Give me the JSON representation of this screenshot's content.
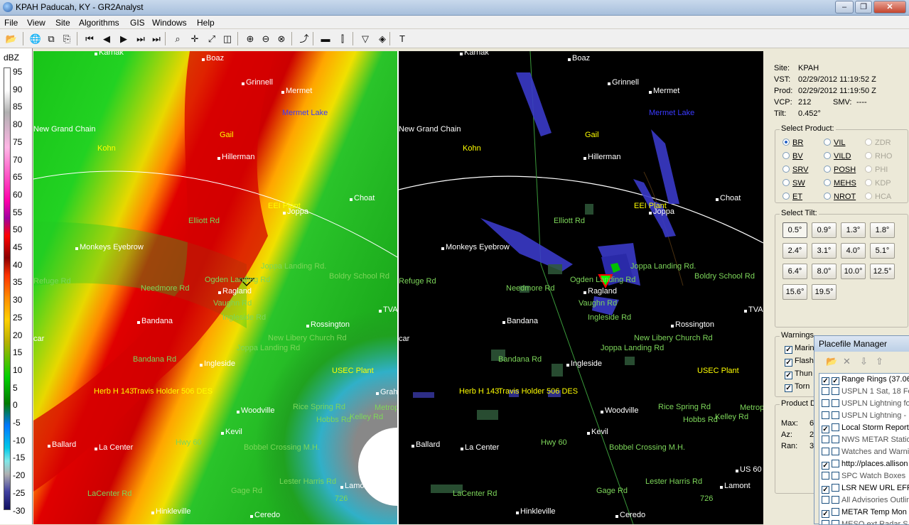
{
  "window": {
    "title": "KPAH Paducah, KY - GR2Analyst",
    "minimize": "–",
    "restore": "❐",
    "close": "✕"
  },
  "menu": [
    "File",
    "View",
    "Site",
    "Algorithms",
    "GIS",
    "Windows",
    "Help"
  ],
  "toolbar": {
    "icons": [
      "open-folder-icon",
      "globe-icon",
      "copy-icon",
      "export-icon",
      "first-frame-icon",
      "previous-frame-icon",
      "play-icon",
      "next-frame-icon",
      "last-frame-icon",
      "zoom-icon",
      "pan-icon",
      "measure-icon",
      "cube-icon",
      "zoom-in-icon",
      "zoom-out-icon",
      "zoom-reset-icon",
      "cross-section-icon",
      "storm-motion-icon",
      "split-icon",
      "filter-icon",
      "filter-options-icon",
      "text-icon"
    ],
    "glyphs": [
      "📂",
      "🌐",
      "⧉",
      "⎘",
      "⏮",
      "◀",
      "▶",
      "⏭",
      "⏭",
      "⌕",
      "✛",
      "⤢",
      "◫",
      "⊕",
      "⊖",
      "⊗",
      "⤴",
      "▬",
      "⫿",
      "▽",
      "◈",
      "T"
    ]
  },
  "colorbar": {
    "unit": "dBZ",
    "ticks": [
      "95",
      "90",
      "85",
      "80",
      "75",
      "70",
      "65",
      "60",
      "55",
      "50",
      "45",
      "40",
      "35",
      "30",
      "25",
      "20",
      "15",
      "10",
      "5",
      "0",
      "-5",
      "-10",
      "-15",
      "-20",
      "-25",
      "-30"
    ]
  },
  "map_labels": {
    "white": [
      "Karnak",
      "Boaz",
      "Grinnell",
      "Mermet",
      "New Grand Chain",
      "Hillerman",
      "Choat",
      "Joppa",
      "Monkeys Eyebrow",
      "Ragland",
      "Bandana",
      "Rossington",
      "Ingleside",
      "Woodville",
      "Kevil",
      "Ballard",
      "La Center",
      "Lamont",
      "Hinkleville",
      "Ceredo",
      "US 60",
      "Grah",
      "TVA",
      "car"
    ],
    "yellow": [
      "Gail",
      "Kohn",
      "EEI Plant",
      "USEC Plant",
      "Herb H 143",
      "Travis Holder 506 DES"
    ],
    "green": [
      "Elliott Rd",
      "Ogden Landing Rd",
      "Joppa Landing Rd.",
      "Boldry School Rd",
      "Needmore Rd",
      "Vaughn Rd",
      "Ingleside Rd",
      "New Libery Church Rd",
      "Joppa Landing Rd",
      "Bandana Rd",
      "Rice Spring Rd",
      "Hobbs Rd",
      "Kelley Rd",
      "Hwy 60",
      "Bobbel Crossing M.H.",
      "Lester Harris Rd",
      "Gage Rd",
      "LaCenter Rd",
      "726",
      "Refuge Rd",
      "Metrop"
    ],
    "blue": [
      "Mermet Lake"
    ]
  },
  "info": {
    "site_label": "Site:",
    "site": "KPAH",
    "vst_label": "VST:",
    "vst": "02/29/2012  11:19:52 Z",
    "prod_label": "Prod:",
    "prod": "02/29/2012  11:19:50 Z",
    "vcp_label": "VCP:",
    "vcp": "212",
    "smv_label": "SMV:",
    "smv": "----",
    "tilt_label": "Tilt:",
    "tilt": "0.452°"
  },
  "select_product": {
    "label": "Select Product:",
    "options": [
      {
        "label": "BR",
        "enabled": true,
        "selected": true
      },
      {
        "label": "VIL",
        "enabled": true
      },
      {
        "label": "ZDR",
        "enabled": false
      },
      {
        "label": "BV",
        "enabled": true
      },
      {
        "label": "VILD",
        "enabled": true
      },
      {
        "label": "RHO",
        "enabled": false
      },
      {
        "label": "SRV",
        "enabled": true
      },
      {
        "label": "POSH",
        "enabled": true
      },
      {
        "label": "PHI",
        "enabled": false
      },
      {
        "label": "SW",
        "enabled": true
      },
      {
        "label": "MEHS",
        "enabled": true
      },
      {
        "label": "KDP",
        "enabled": false
      },
      {
        "label": "ET",
        "enabled": true
      },
      {
        "label": "NROT",
        "enabled": true
      },
      {
        "label": "HCA",
        "enabled": false
      }
    ]
  },
  "select_tilt": {
    "label": "Select Tilt:",
    "options": [
      "0.5°",
      "0.9°",
      "1.3°",
      "1.8°",
      "2.4°",
      "3.1°",
      "4.0°",
      "5.1°",
      "6.4°",
      "8.0°",
      "10.0°",
      "12.5°",
      "15.6°",
      "19.5°"
    ],
    "selected": "0.5°"
  },
  "warnings": {
    "label": "Warnings",
    "items": [
      "Marin",
      "Flash",
      "Thun",
      "Torn"
    ]
  },
  "product_data": {
    "label": "Product D",
    "max_label": "Max:",
    "max": "6",
    "az_label": "Az:",
    "az": "2",
    "ran_label": "Ran:",
    "ran": "3"
  },
  "placefile_manager": {
    "title": "Placefile Manager",
    "items": [
      {
        "label": "Range Rings (37.06",
        "a": true,
        "b": true
      },
      {
        "label": "USPLN 1 Sat, 18 Fe",
        "a": false,
        "b": false
      },
      {
        "label": "USPLN Lightning fo",
        "a": false,
        "b": false
      },
      {
        "label": "USPLN Lightning - ",
        "a": false,
        "b": false
      },
      {
        "label": "Local Storm Reports",
        "a": true,
        "b": false
      },
      {
        "label": "NWS METAR Statio",
        "a": false,
        "b": false
      },
      {
        "label": "Watches and Warni",
        "a": false,
        "b": false
      },
      {
        "label": "http://places.allison",
        "a": true,
        "b": false
      },
      {
        "label": "SPC Watch Boxes",
        "a": false,
        "b": false
      },
      {
        "label": "LSR NEW URL EFF",
        "a": true,
        "b": false
      },
      {
        "label": "All Advisories Outlin",
        "a": false,
        "b": false
      },
      {
        "label": "METAR Temp Mon",
        "a": true,
        "b": false
      },
      {
        "label": "MESO ext Radar S",
        "a": false,
        "b": false
      }
    ]
  }
}
